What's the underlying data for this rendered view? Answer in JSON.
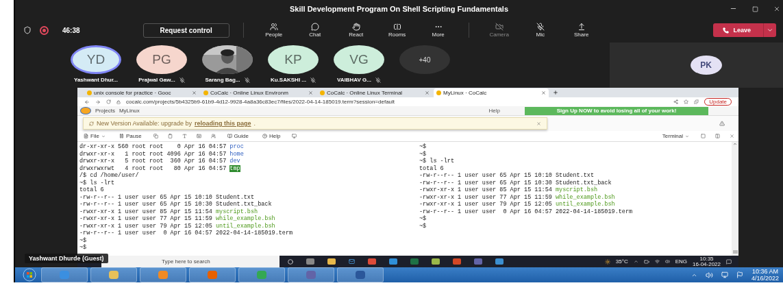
{
  "window": {
    "title": "Skill Development Program On Shell Scripting Fundamentals"
  },
  "toolbar": {
    "timer": "46:38",
    "recording": true,
    "request_control": "Request control",
    "leave": "Leave",
    "actions": [
      {
        "label": "People",
        "kind": "people",
        "disabled": false
      },
      {
        "label": "Chat",
        "kind": "chat",
        "disabled": false
      },
      {
        "label": "React",
        "kind": "react",
        "disabled": false
      },
      {
        "label": "Rooms",
        "kind": "rooms",
        "disabled": false
      },
      {
        "label": "More",
        "kind": "more",
        "disabled": false
      },
      {
        "label": "Camera",
        "kind": "camera",
        "disabled": true
      },
      {
        "label": "Mic",
        "kind": "mic",
        "disabled": false
      },
      {
        "label": "Share",
        "kind": "share",
        "disabled": false
      }
    ]
  },
  "participants": [
    {
      "kind": "initials",
      "initials": "YD",
      "name": "Yashwant Dhur...",
      "color": "#d4ebf5",
      "muted": false,
      "speaking": true
    },
    {
      "kind": "initials",
      "initials": "PG",
      "name": "Prajwal Gaw...",
      "color": "#f6d6cd",
      "muted": true,
      "speaking": false
    },
    {
      "kind": "picture",
      "name": "Sarang Bag...",
      "muted": true,
      "speaking": false
    },
    {
      "kind": "initials",
      "initials": "KP",
      "name": "Ku.SAKSHI ...",
      "color": "#cdeedb",
      "muted": true,
      "speaking": false
    },
    {
      "kind": "initials",
      "initials": "VG",
      "name": "VAIBHAV G...",
      "color": "#cdeedb",
      "muted": true,
      "speaking": false
    },
    {
      "kind": "overflow",
      "initials": "+40"
    }
  ],
  "spotlight": {
    "initials": "PK",
    "color": "#e4e1f4"
  },
  "browser": {
    "tabs": [
      {
        "title": "unix console for practice · Gooc",
        "selected": false
      },
      {
        "title": "CoCalc · Online Linux Environm",
        "selected": false
      },
      {
        "title": "CoCalc · Online Linux Terminal",
        "selected": false
      },
      {
        "title": "MyLinux · CoCalc",
        "selected": true
      }
    ],
    "url": "cocalc.com/projects/5b4325b9-61b9-4d12-9928-4a8a36c83ec7/files/2022-04-14-185019.term?session=default",
    "update": "Update"
  },
  "cocalc": {
    "projects": "Projects",
    "project": "MyLinux",
    "help": "Help",
    "signup": "Sign Up NOW to avoid losing all of your work!",
    "notice": {
      "text": "New Version Available: upgrade by",
      "link": "reloading this page",
      "after": "."
    },
    "terminal_bar": {
      "file": "File",
      "pause": "Pause",
      "guide": "Guide",
      "help": "Help",
      "mode": "Terminal"
    },
    "lines": [
      {
        "text": "dr-xr-xr-x 560 root root    0 Apr 16 04:57 ",
        "file": "proc",
        "kind": "dir"
      },
      {
        "text": "drwxr-xr-x   1 root root 4096 Apr 16 04:57 ",
        "file": "home",
        "kind": "dir"
      },
      {
        "text": "drwxr-xr-x   5 root root  360 Apr 16 04:57 ",
        "file": "dev",
        "kind": "dir"
      },
      {
        "text": "drwxrwxrwt   4 root root   80 Apr 16 04:57 ",
        "file": "tmp",
        "kind": "sticky"
      },
      {
        "text": "/$ cd /home/user/",
        "kind": "plain"
      },
      {
        "text": "~$ ls -lrt",
        "kind": "plain"
      },
      {
        "text": "total 6",
        "kind": "plain"
      },
      {
        "text": "-rw-r--r-- 1 user user 65 Apr 15 10:10 Student.txt",
        "kind": "plain"
      },
      {
        "text": "-rw-r--r-- 1 user user 65 Apr 15 10:30 Student.txt_back",
        "kind": "plain"
      },
      {
        "text": "-rwxr-xr-x 1 user user 85 Apr 15 11:54 ",
        "file": "myscript.bsh",
        "kind": "exec"
      },
      {
        "text": "-rwxr-xr-x 1 user user 77 Apr 15 11:59 ",
        "file": "while_example.bsh",
        "kind": "exec"
      },
      {
        "text": "-rwxr-xr-x 1 user user 79 Apr 15 12:05 ",
        "file": "until_example.bsh",
        "kind": "exec"
      },
      {
        "text": "-rw-r--r-- 1 user user  0 Apr 16 04:57 2022-04-14-185019.term",
        "kind": "plain"
      },
      {
        "text": "~$",
        "kind": "plain"
      },
      {
        "text": "~$",
        "kind": "plain"
      },
      {
        "text": "~$",
        "kind": "plain"
      },
      {
        "text": "~$",
        "kind": "plain"
      },
      {
        "text": "~$ ls -lrt",
        "kind": "plain"
      },
      {
        "text": "total 6",
        "kind": "plain"
      },
      {
        "text": "-rw-r--r-- 1 user user 65 Apr 15 10:10 Student.txt",
        "kind": "plain"
      },
      {
        "text": "-rw-r--r-- 1 user user 65 Apr 15 10:30 Student.txt_back",
        "kind": "plain"
      },
      {
        "text": "-rwxr-xr-x 1 user user 85 Apr 15 11:54 ",
        "file": "myscript.bsh",
        "kind": "exec"
      },
      {
        "text": "-rwxr-xr-x 1 user user 77 Apr 15 11:59 ",
        "file": "while_example.bsh",
        "kind": "exec"
      },
      {
        "text": "-rwxr-xr-x 1 user user 79 Apr 15 12:05 ",
        "file": "until_example.bsh",
        "kind": "exec"
      },
      {
        "text": "-rw-r--r-- 1 user user  0 Apr 16 04:57 2022-04-14-185019.term",
        "kind": "plain"
      },
      {
        "text": "~$",
        "kind": "plain"
      },
      {
        "text": "~$",
        "kind": "plain"
      }
    ]
  },
  "shared_taskbar": {
    "search": "Type here to search",
    "weather": "35°C",
    "language": "ENG",
    "time": "10:35",
    "date": "16-04-2022"
  },
  "presenter": "Yashwant Dhurde (Guest)",
  "host_taskbar": {
    "time": "10:36 AM",
    "date": "4/16/2022"
  }
}
